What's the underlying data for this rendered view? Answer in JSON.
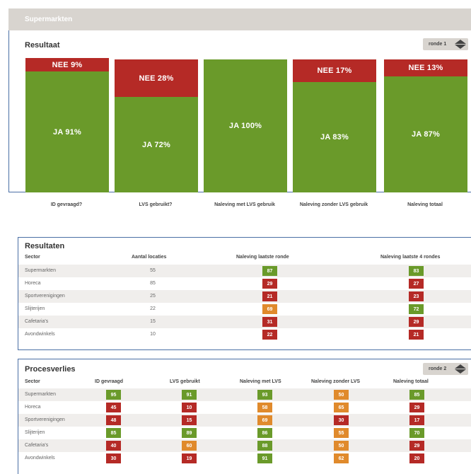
{
  "panel1": {
    "header": "Supermarkten",
    "title": "Resultaat",
    "ronde_label": "ronde 1",
    "bars": [
      {
        "label": "ID gevraagd?",
        "ja": "JA 91%",
        "nee": "NEE 9%",
        "ja_value": 91,
        "nee_value": 9
      },
      {
        "label": "LVS gebruikt?",
        "ja": "JA 72%",
        "nee": "NEE 28%",
        "ja_value": 72,
        "nee_value": 28
      },
      {
        "label": "Naleving met LVS gebruik",
        "ja": "JA 100%",
        "nee": "",
        "ja_value": 100,
        "nee_value": 0
      },
      {
        "label": "Naleving zonder LVS gebruik",
        "ja": "JA 83%",
        "nee": "NEE 17%",
        "ja_value": 83,
        "nee_value": 17
      },
      {
        "label": "Naleving totaal",
        "ja": "JA 87%",
        "nee": "NEE 13%",
        "ja_value": 87,
        "nee_value": 13
      }
    ]
  },
  "resultaten": {
    "title": "Resultaten",
    "headers": [
      "Sector",
      "Aantal locaties",
      "Naleving laatste ronde",
      "Naleving laatste 4 rondes"
    ],
    "rows": [
      {
        "sector": "Supermarkten",
        "locaties": "55",
        "laatste": "87",
        "laatste_color": "green",
        "vier": "83",
        "vier_color": "green"
      },
      {
        "sector": "Horeca",
        "locaties": "85",
        "laatste": "29",
        "laatste_color": "red",
        "vier": "27",
        "vier_color": "red"
      },
      {
        "sector": "Sportverenigingen",
        "locaties": "25",
        "laatste": "21",
        "laatste_color": "red",
        "vier": "23",
        "vier_color": "red"
      },
      {
        "sector": "Slijterijen",
        "locaties": "22",
        "laatste": "69",
        "laatste_color": "orange",
        "vier": "72",
        "vier_color": "green"
      },
      {
        "sector": "Cafetaria's",
        "locaties": "15",
        "laatste": "31",
        "laatste_color": "red",
        "vier": "29",
        "vier_color": "red"
      },
      {
        "sector": "Avondwinkels",
        "locaties": "10",
        "laatste": "22",
        "laatste_color": "red",
        "vier": "21",
        "vier_color": "red"
      }
    ]
  },
  "procesverlies": {
    "title": "Procesverlies",
    "ronde_label": "ronde 2",
    "headers": [
      "Sector",
      "ID gevraagd",
      "LVS gebruikt",
      "Naleving met LVS",
      "Naleving zonder LVS",
      "Naleving totaal"
    ],
    "rows": [
      {
        "sector": "Supermarkten",
        "cells": [
          {
            "v": "95",
            "c": "green"
          },
          {
            "v": "91",
            "c": "green"
          },
          {
            "v": "93",
            "c": "green"
          },
          {
            "v": "50",
            "c": "orange"
          },
          {
            "v": "85",
            "c": "green"
          }
        ]
      },
      {
        "sector": "Horeca",
        "cells": [
          {
            "v": "45",
            "c": "red"
          },
          {
            "v": "10",
            "c": "red"
          },
          {
            "v": "58",
            "c": "orange"
          },
          {
            "v": "65",
            "c": "orange"
          },
          {
            "v": "29",
            "c": "red"
          }
        ]
      },
      {
        "sector": "Sportverenigingen",
        "cells": [
          {
            "v": "48",
            "c": "red"
          },
          {
            "v": "15",
            "c": "red"
          },
          {
            "v": "69",
            "c": "orange"
          },
          {
            "v": "30",
            "c": "red"
          },
          {
            "v": "17",
            "c": "red"
          }
        ]
      },
      {
        "sector": "Slijterijen",
        "cells": [
          {
            "v": "85",
            "c": "green"
          },
          {
            "v": "89",
            "c": "green"
          },
          {
            "v": "86",
            "c": "green"
          },
          {
            "v": "55",
            "c": "orange"
          },
          {
            "v": "70",
            "c": "green"
          }
        ]
      },
      {
        "sector": "Cafetaria's",
        "cells": [
          {
            "v": "40",
            "c": "red"
          },
          {
            "v": "60",
            "c": "orange"
          },
          {
            "v": "88",
            "c": "green"
          },
          {
            "v": "50",
            "c": "orange"
          },
          {
            "v": "29",
            "c": "red"
          }
        ]
      },
      {
        "sector": "Avondwinkels",
        "cells": [
          {
            "v": "30",
            "c": "red"
          },
          {
            "v": "19",
            "c": "red"
          },
          {
            "v": "91",
            "c": "green"
          },
          {
            "v": "62",
            "c": "orange"
          },
          {
            "v": "20",
            "c": "red"
          }
        ]
      }
    ]
  },
  "colors": {
    "green": "#6a9a2a",
    "red": "#b52a26",
    "orange": "#e08a2c",
    "header": "#d8d4cf"
  }
}
